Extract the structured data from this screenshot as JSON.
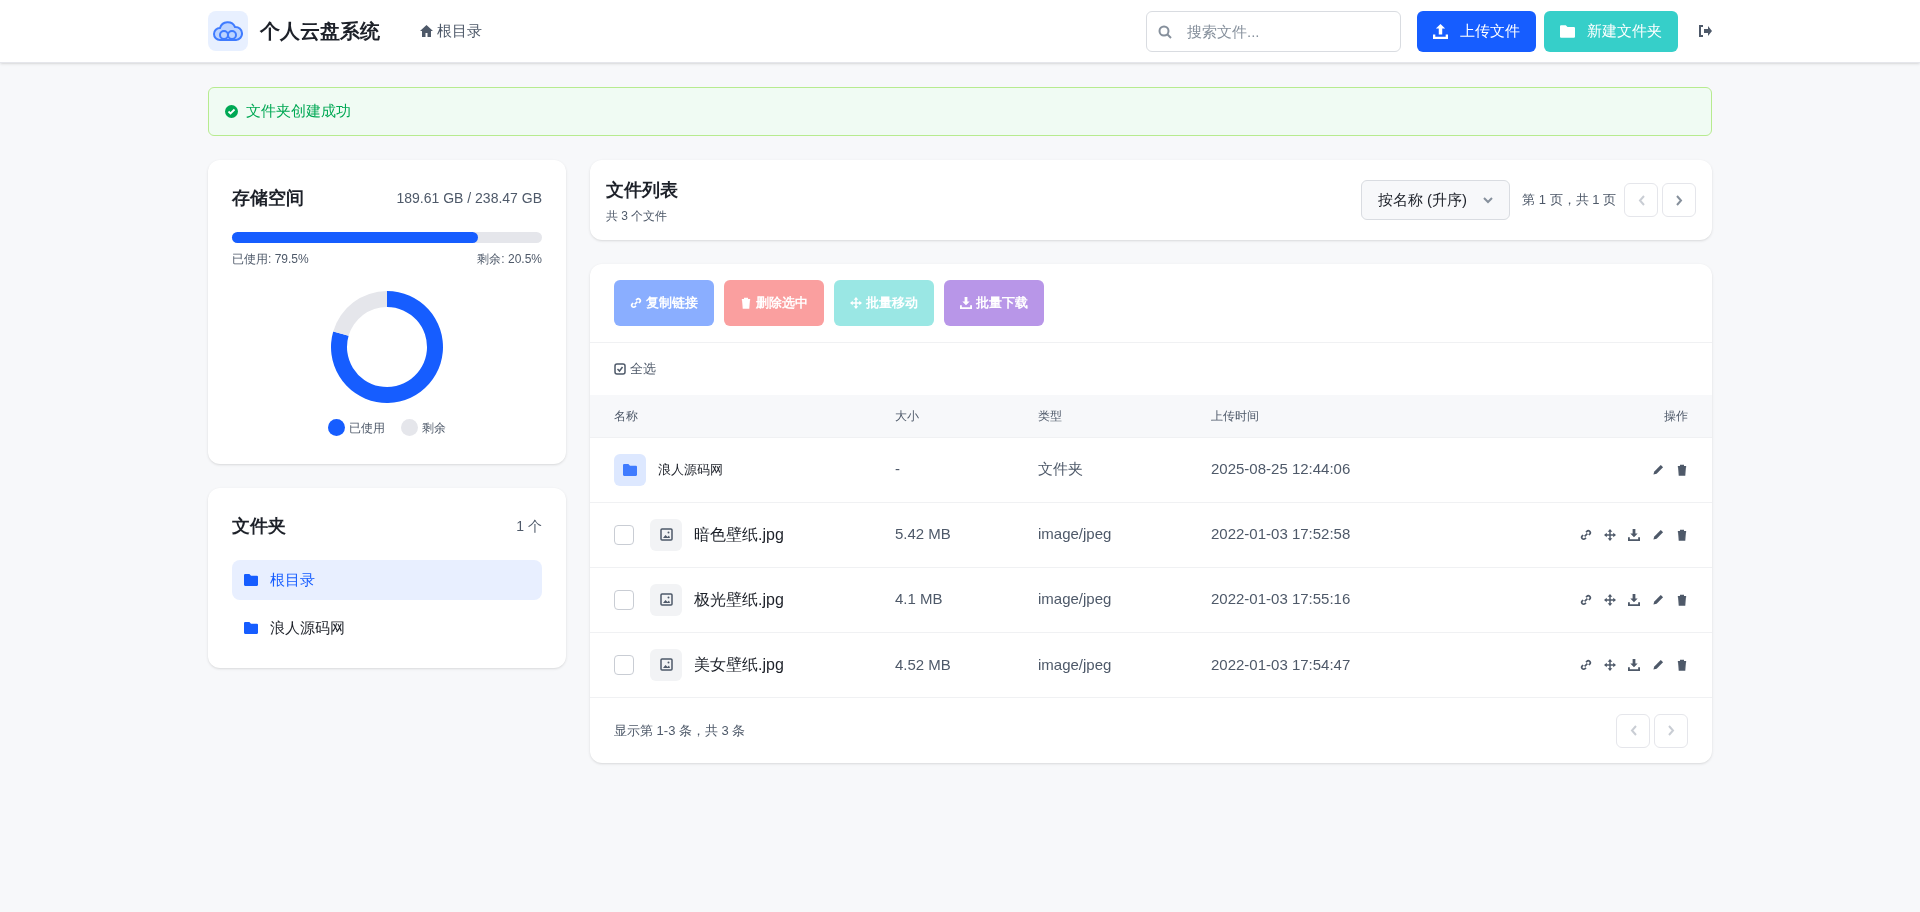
{
  "header": {
    "title": "个人云盘系统",
    "breadcrumb": "根目录",
    "search": {
      "placeholder": "搜索文件..."
    },
    "buttons": [
      {
        "kind": "upload",
        "label": "上传文件"
      },
      {
        "kind": "new-folder",
        "label": "新建文件夹"
      }
    ]
  },
  "alert": {
    "text": "文件夹创建成功"
  },
  "storage": {
    "title": "存储空间",
    "usage": "189.61 GB / 238.47 GB",
    "level": 0.795,
    "used_label": "已使用: 79.5%",
    "free_label": "剩余: 20.5%",
    "chart_data": {
      "type": "donut",
      "categories": [
        "已使用",
        "剩余"
      ],
      "values": [
        79.5,
        20.5
      ],
      "legend": "bottom",
      "colors": [
        "#165dff",
        "#e5e6eb"
      ]
    }
  },
  "folders": {
    "title": "文件夹",
    "count": "1 个",
    "items": [
      {
        "label": "根目录",
        "selected": true
      },
      {
        "label": "浪人源码网",
        "selected": false
      }
    ]
  },
  "file_list": {
    "title": "文件列表",
    "subtitle": "共 3 个文件",
    "sort": "按名称 (升序)",
    "page_info": "第 1 页，共 1 页"
  },
  "batch_buttons": [
    {
      "kind": "link",
      "label": "复制链接",
      "disabled": true
    },
    {
      "kind": "delete",
      "label": "删除选中",
      "disabled": true
    },
    {
      "kind": "move",
      "label": "批量移动",
      "disabled": true
    },
    {
      "kind": "download",
      "label": "批量下载",
      "disabled": true
    }
  ],
  "select_all": "全选",
  "table": {
    "columns": [
      "名称",
      "大小",
      "类型",
      "上传时间",
      "操作"
    ],
    "rows": [
      {
        "kind": "folder",
        "name": "浪人源码网",
        "size": "-",
        "type": "文件夹",
        "uploaded": "2025-08-25 12:44:06"
      },
      {
        "kind": "file",
        "checked": false,
        "name": "暗色壁纸.jpg",
        "size": "5.42 MB",
        "type": "image/jpeg",
        "uploaded": "2022-01-03 17:52:58"
      },
      {
        "kind": "file",
        "checked": false,
        "name": "极光壁纸.jpg",
        "size": "4.1 MB",
        "type": "image/jpeg",
        "uploaded": "2022-01-03 17:55:16"
      },
      {
        "kind": "file",
        "checked": false,
        "name": "美女壁纸.jpg",
        "size": "4.52 MB",
        "type": "image/jpeg",
        "uploaded": "2022-01-03 17:54:47"
      }
    ]
  },
  "footer": "显示第 1-3 条，共 3 条"
}
